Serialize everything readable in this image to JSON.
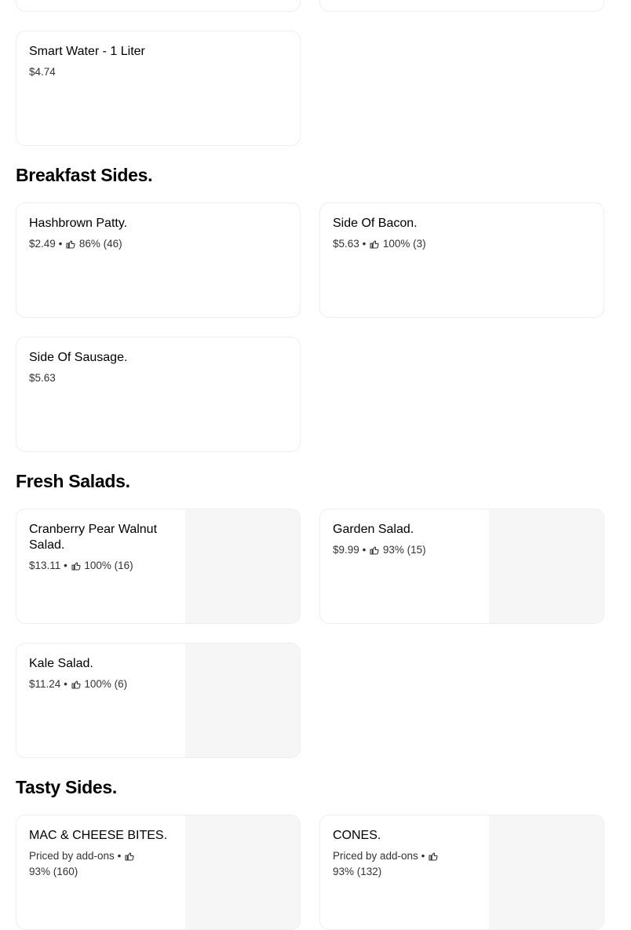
{
  "sections": [
    {
      "title": "",
      "items": [
        {
          "name": "Smart Water - 1 Liter",
          "price": "$4.74",
          "dot": "",
          "rating": ""
        }
      ]
    },
    {
      "title": "Breakfast Sides.",
      "items": [
        {
          "name": "Hashbrown Patty.",
          "price": "$2.49",
          "dot": "•",
          "rating": "86% (46)"
        },
        {
          "name": "Side Of Bacon.",
          "price": "$5.63",
          "dot": "•",
          "rating": "100% (3)"
        },
        {
          "name": "Side Of Sausage.",
          "price": "$5.63",
          "dot": "",
          "rating": ""
        }
      ]
    },
    {
      "title": "Fresh Salads.",
      "items": [
        {
          "name": "Cranberry Pear Walnut Salad.",
          "price": "$13.11",
          "dot": "•",
          "rating": "100% (16)"
        },
        {
          "name": "Garden Salad.",
          "price": "$9.99",
          "dot": "•",
          "rating": "93% (15)"
        },
        {
          "name": "Kale Salad.",
          "price": "$11.24",
          "dot": "•",
          "rating": "100% (6)"
        }
      ]
    },
    {
      "title": "Tasty Sides.",
      "items": [
        {
          "name": "MAC & CHEESE BITES.",
          "price": "Priced by add-ons",
          "dot": "•",
          "rating": "93% (160)"
        },
        {
          "name": "CONES.",
          "price": "Priced by add-ons",
          "dot": "•",
          "rating": "93% (132)"
        }
      ]
    }
  ],
  "icons": {
    "rating": "thumbs-up-icon"
  },
  "colors": {
    "card_border": "#eeeeee",
    "image_placeholder": "#f6f6f6",
    "meta_text": "#333333"
  }
}
